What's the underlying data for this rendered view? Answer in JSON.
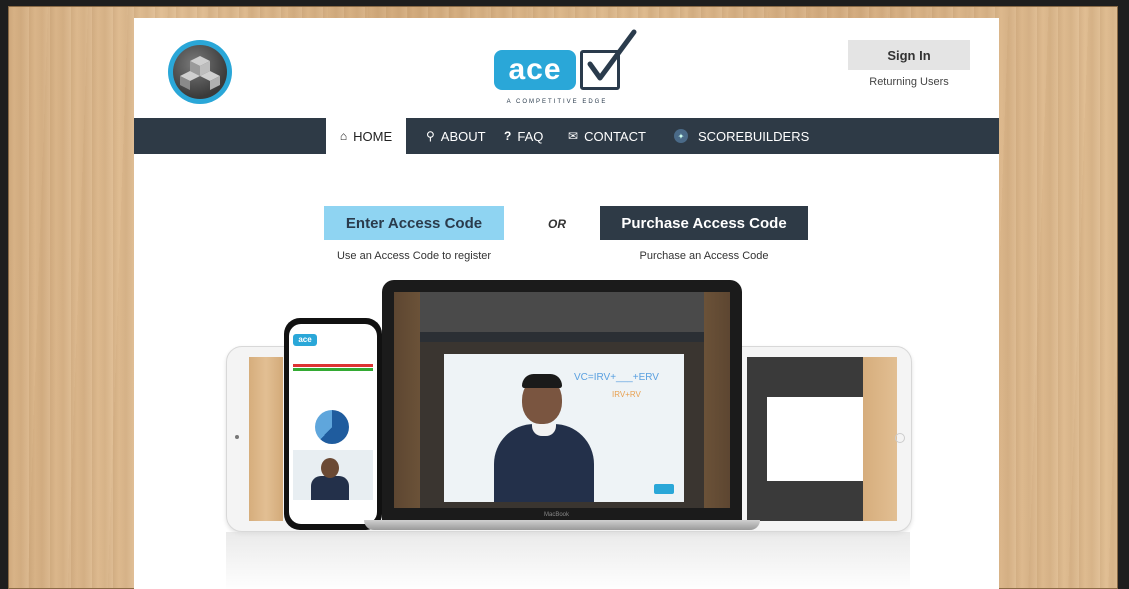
{
  "header": {
    "brand_word": "ace",
    "brand_tagline": "A COMPETITIVE EDGE",
    "signin_label": "Sign In",
    "signin_sub": "Returning Users"
  },
  "nav": {
    "items": [
      {
        "label": "HOME",
        "icon": "home-icon",
        "active": true
      },
      {
        "label": "ABOUT",
        "icon": "lightbulb-icon"
      },
      {
        "label": "FAQ",
        "icon": "question-icon"
      },
      {
        "label": "CONTACT",
        "icon": "envelope-icon"
      },
      {
        "label": "SCOREBUILDERS",
        "icon": "scorebuilders-logo-icon"
      }
    ]
  },
  "cta": {
    "enter_label": "Enter Access Code",
    "or_label": "OR",
    "purchase_label": "Purchase Access Code",
    "enter_sub": "Use an Access Code to register",
    "purchase_sub": "Purchase an Access Code"
  },
  "showcase": {
    "video_formula": "VC=IRV+___+ERV",
    "video_formula_2": "IRV+RV",
    "laptop_label": "MacBook"
  },
  "colors": {
    "accent": "#2aa7d8",
    "nav_bg": "#2e3a46",
    "enter_btn": "#8fd4f2"
  }
}
